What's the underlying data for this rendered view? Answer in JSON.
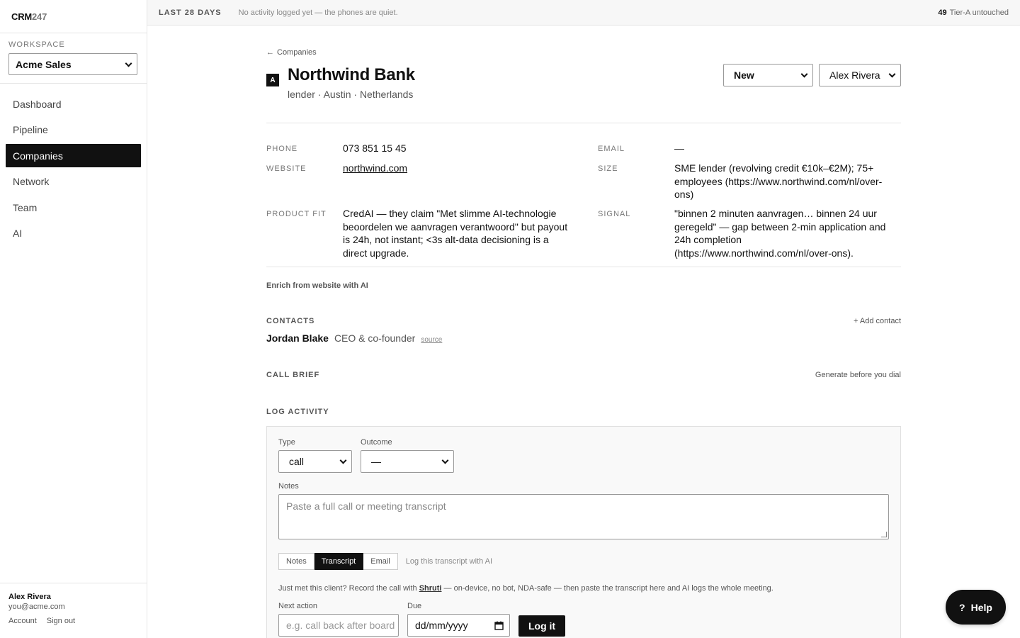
{
  "brand": {
    "part1": "CRM",
    "part2": "247"
  },
  "workspace": {
    "label": "WORKSPACE",
    "selected": "Acme Sales"
  },
  "nav": {
    "items": [
      {
        "label": "Dashboard"
      },
      {
        "label": "Pipeline"
      },
      {
        "label": "Companies"
      },
      {
        "label": "Network"
      },
      {
        "label": "Team"
      },
      {
        "label": "AI"
      }
    ],
    "active": "Companies"
  },
  "user": {
    "name": "Alex Rivera",
    "email": "you@acme.com",
    "account_link": "Account",
    "signout_link": "Sign out"
  },
  "topbar": {
    "range": "LAST 28 DAYS",
    "message": "No activity logged yet — the phones are quiet.",
    "count": "49",
    "count_label": "Tier-A untouched"
  },
  "company": {
    "back_label": "Companies",
    "tier": "A",
    "name": "Northwind Bank",
    "subtitle": "lender · Austin · Netherlands",
    "status": "New",
    "owner": "Alex Rivera",
    "fields": {
      "phone_label": "PHONE",
      "phone": "073 851 15 45",
      "email_label": "EMAIL",
      "email": "—",
      "website_label": "WEBSITE",
      "website": "northwind.com",
      "size_label": "SIZE",
      "size": "SME lender (revolving credit €10k–€2M); 75+ employees (https://www.northwind.com/nl/over-ons)",
      "fit_label": "PRODUCT FIT",
      "fit": "CredAI — they claim \"Met slimme AI-technologie beoordelen we aanvragen verantwoord\" but payout is 24h, not instant; <3s alt-data decisioning is a direct upgrade.",
      "signal_label": "SIGNAL",
      "signal": "\"binnen 2 minuten aanvragen… binnen 24 uur geregeld\" — gap between 2-min application and 24h completion (https://www.northwind.com/nl/over-ons)."
    },
    "enrich_label": "Enrich from website with AI"
  },
  "contacts": {
    "title": "CONTACTS",
    "add_label": "+ Add contact",
    "items": [
      {
        "name": "Jordan Blake",
        "role": "CEO & co-founder",
        "source": "source"
      }
    ]
  },
  "call_brief": {
    "title": "CALL BRIEF",
    "action": "Generate before you dial"
  },
  "log": {
    "title": "LOG ACTIVITY",
    "type_label": "Type",
    "type_value": "call",
    "outcome_label": "Outcome",
    "outcome_value": "—",
    "notes_label": "Notes",
    "notes_placeholder": "Paste a full call or meeting transcript",
    "tabs": [
      "Notes",
      "Transcript",
      "Email"
    ],
    "active_tab": "Transcript",
    "ai_label": "Log this transcript with AI",
    "hint_before": "Just met this client? Record the call with ",
    "hint_link": "Shruti",
    "hint_after": " — on-device, no bot, NDA-safe — then paste the transcript here and AI logs the whole meeting.",
    "next_label": "Next action",
    "next_placeholder": "e.g. call back after board",
    "due_label": "Due",
    "due_placeholder": "dd/mm/yyyy",
    "submit": "Log it"
  },
  "help": {
    "icon": "?",
    "label": "Help"
  },
  "colors": {
    "accent": "#111111",
    "muted": "#777777",
    "border": "#e5e5e5"
  }
}
